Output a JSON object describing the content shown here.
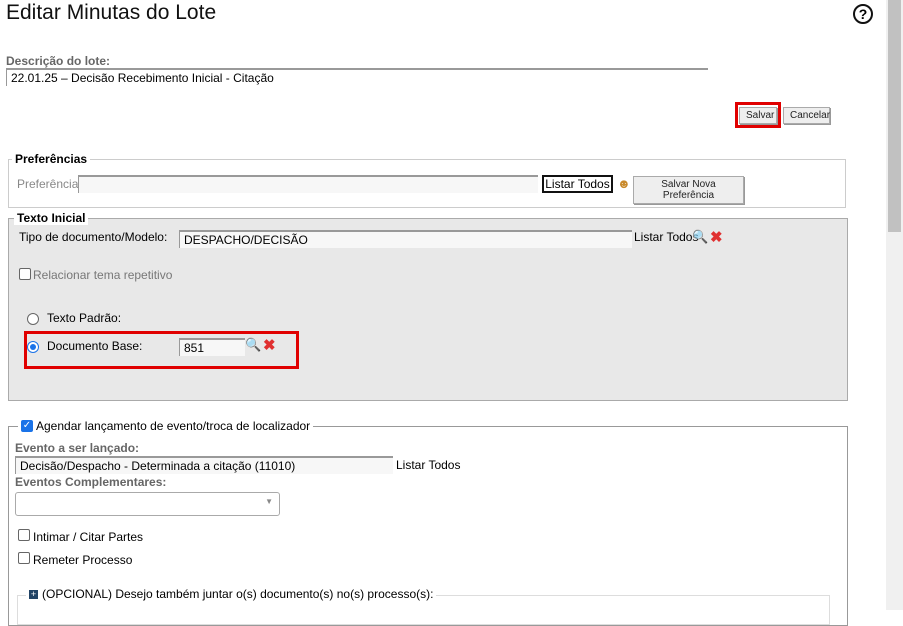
{
  "page": {
    "title": "Editar Minutas do Lote",
    "help_icon": "help-circle-icon"
  },
  "descricao": {
    "label": "Descrição do lote:",
    "value": "22.01.25 – Decisão Recebimento Inicial - Citação"
  },
  "actions": {
    "save": "Salvar",
    "cancel": "Cancelar",
    "highlight_color": "#e00000"
  },
  "preferencias": {
    "legend": "Preferências",
    "label": "Preferência:",
    "value": "",
    "list_all": "Listar Todos",
    "save_new": "Salvar Nova Preferência"
  },
  "texto_inicial": {
    "legend": "Texto Inicial",
    "tipo_label": "Tipo de documento/Modelo:",
    "tipo_value": "DESPACHO/DECISÃO",
    "list_all": "Listar Todos",
    "relacionar_label": "Relacionar tema repetitivo",
    "relacionar_checked": false,
    "texto_padrao_label": "Texto Padrão:",
    "documento_base_label": "Documento Base:",
    "documento_base_value": "851",
    "selected": "documento_base"
  },
  "agendar": {
    "legend": "Agendar lançamento de evento/troca de localizador",
    "checked": true,
    "evento_label": "Evento a ser lançado:",
    "evento_value": "Decisão/Despacho - Determinada a citação (11010)",
    "list_all": "Listar Todos",
    "complementares_label": "Eventos Complementares:",
    "complementares_value": "",
    "intimar_label": "Intimar / Citar Partes",
    "intimar_checked": false,
    "remeter_label": "Remeter Processo",
    "remeter_checked": false,
    "opcional_legend": "(OPCIONAL) Desejo também juntar o(s) documento(s) no(s) processo(s):"
  }
}
